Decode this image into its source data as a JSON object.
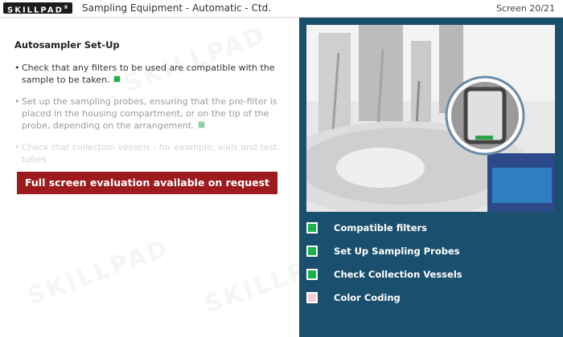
{
  "header": {
    "logo_text": "SKILLPAD",
    "logo_mark": "®",
    "title": "Sampling Equipment - Automatic - Ctd.",
    "screen_counter": "Screen 20/21"
  },
  "content": {
    "section_title": "Autosampler Set-Up",
    "bullets": [
      {
        "text": "Check that any filters to be used are compatible with the sample to be taken."
      },
      {
        "text": "Set up the sampling probes, ensuring that the pre-filter is placed in the housing compartment, or on the tip of the probe, depending on the arrangement."
      },
      {
        "text": "Check that collection vessels - for example, vials and test tubes"
      }
    ],
    "evaluation_banner": "Full screen evaluation available on request"
  },
  "watermark_text": "SKILLPAD",
  "right_panel": {
    "image_icon": "autosampler-photo",
    "items": [
      {
        "label": "Compatible filters",
        "color": "#1db24a"
      },
      {
        "label": "Set Up Sampling Probes",
        "color": "#1db24a"
      },
      {
        "label": "Check Collection Vessels",
        "color": "#1db24a"
      },
      {
        "label": "Color Coding",
        "color": "#f6c9db"
      }
    ]
  }
}
